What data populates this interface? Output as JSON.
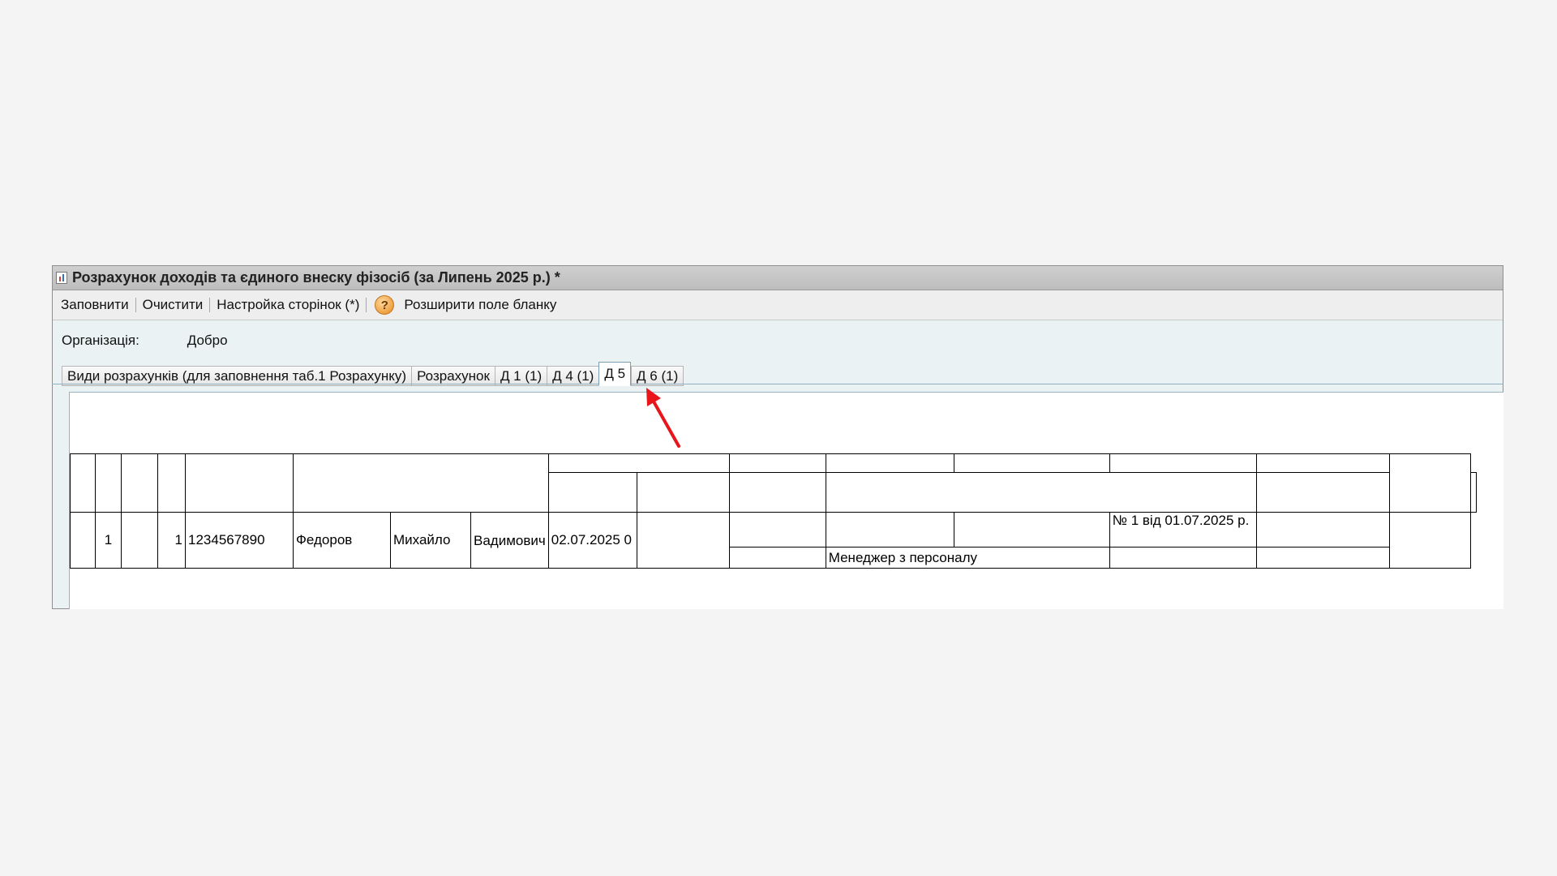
{
  "window": {
    "title": "Розрахунок доходів та єдиного внеску фізосіб (за Липень 2025 р.) *"
  },
  "toolbar": {
    "fill_label": "Заповнити",
    "clear_label": "Очистити",
    "page_setup_label": "Настройка сторінок (*)",
    "help_icon_glyph": "?",
    "expand_label": "Розширити поле бланку"
  },
  "organization": {
    "label": "Організація:",
    "value": "Добро"
  },
  "tabs": [
    {
      "label": "Види розрахунків (для заповнення таб.1 Розрахунку)"
    },
    {
      "label": "Розрахунок"
    },
    {
      "label": "Д 1 (1)"
    },
    {
      "label": "Д 4 (1)"
    },
    {
      "label": "Д 5",
      "active": true
    },
    {
      "label": "Д 6 (1)"
    }
  ],
  "table": {
    "row": {
      "num": "1",
      "num2": "1",
      "tax_id": "1234567890",
      "last_name": "Федоров",
      "first_name": "Михайло",
      "patronymic": "Вадимович",
      "date": "02.07.2025 0",
      "document": "№ 1 від 01.07.2025 р.",
      "position": "Менеджер з персоналу"
    }
  },
  "annotation": {
    "arrow_color": "#e8151b"
  }
}
